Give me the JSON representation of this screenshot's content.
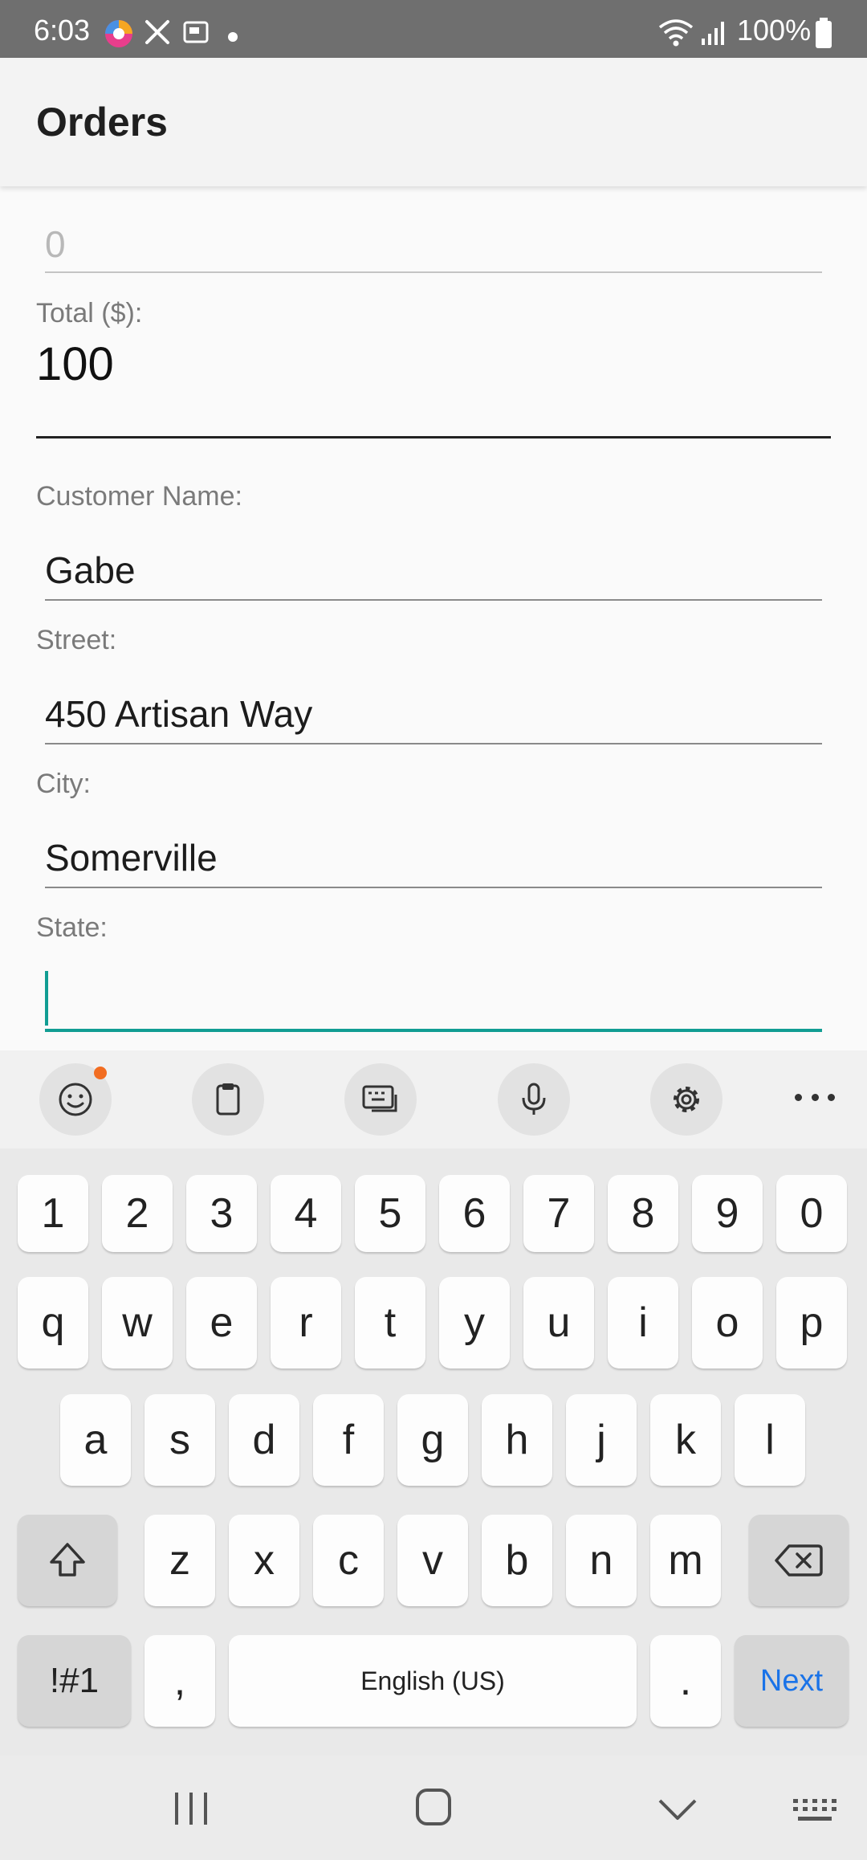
{
  "status_bar": {
    "time": "6:03",
    "battery": "100%",
    "icons": [
      "browser-icon",
      "tools-icon",
      "screenshot-icon",
      "wifi-icon",
      "signal-icon",
      "battery-icon"
    ]
  },
  "app_bar": {
    "title": "Orders"
  },
  "form": {
    "discount": {
      "value": "0"
    },
    "total": {
      "label": "Total ($):",
      "value": "100"
    },
    "customer_name": {
      "label": "Customer Name:",
      "value": "Gabe"
    },
    "street": {
      "label": "Street:",
      "value": "450 Artisan Way"
    },
    "city": {
      "label": "City:",
      "value": "Somerville"
    },
    "state": {
      "label": "State:",
      "value": ""
    }
  },
  "keyboard": {
    "toolbar": [
      "emoji-icon",
      "clipboard-icon",
      "keyboard-mode-icon",
      "microphone-icon",
      "settings-icon",
      "more-icon"
    ],
    "row_numbers": [
      "1",
      "2",
      "3",
      "4",
      "5",
      "6",
      "7",
      "8",
      "9",
      "0"
    ],
    "row_1": [
      "q",
      "w",
      "e",
      "r",
      "t",
      "y",
      "u",
      "i",
      "o",
      "p"
    ],
    "row_2": [
      "a",
      "s",
      "d",
      "f",
      "g",
      "h",
      "j",
      "k",
      "l"
    ],
    "row_3": [
      "z",
      "x",
      "c",
      "v",
      "b",
      "n",
      "m"
    ],
    "symbols_label": "!#1",
    "comma": ",",
    "space_label": "English (US)",
    "period": ".",
    "next_label": "Next"
  },
  "nav_bar": [
    "recent-apps-icon",
    "home-icon",
    "back-icon",
    "keyboard-switch-icon"
  ],
  "colors": {
    "accent": "#119d93",
    "status_bar": "#6f6f6f",
    "notification_dot": "#f26d21",
    "next_key": "#1a73e8"
  }
}
